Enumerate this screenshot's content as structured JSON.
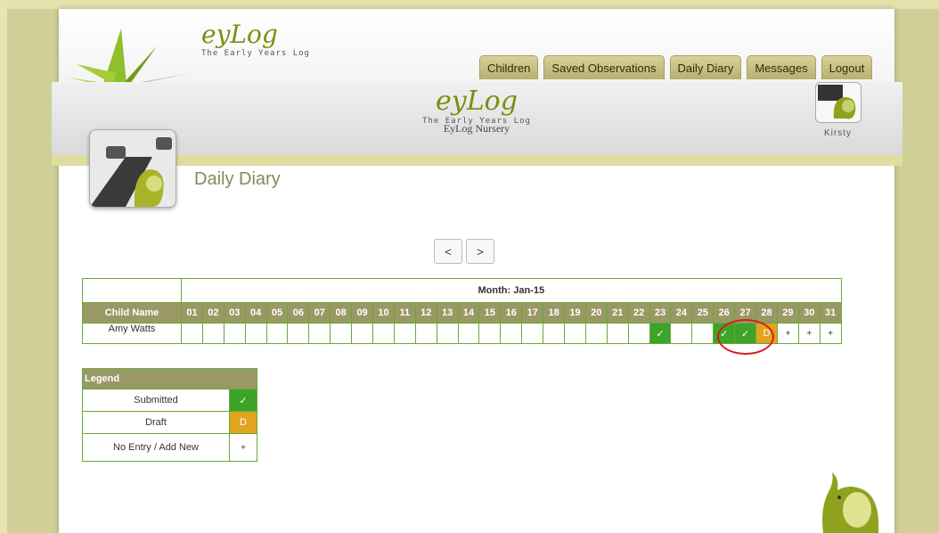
{
  "app": {
    "logo_word": "eyLog",
    "logo_tagline": "The Early Years Log",
    "nursery_name": "EyLog Nursery",
    "user_name": "Kirsty"
  },
  "tabs": [
    "Children",
    "Saved Observations",
    "Daily Diary",
    "Messages",
    "Logout"
  ],
  "page": {
    "title": "Daily Diary"
  },
  "nav": {
    "prev": "<",
    "next": ">"
  },
  "diary": {
    "month_label": "Month: Jan-15",
    "name_header": "Child Name",
    "days": [
      "01",
      "02",
      "03",
      "04",
      "05",
      "06",
      "07",
      "08",
      "09",
      "10",
      "11",
      "12",
      "13",
      "14",
      "15",
      "16",
      "17",
      "18",
      "19",
      "20",
      "21",
      "22",
      "23",
      "24",
      "25",
      "26",
      "27",
      "28",
      "29",
      "30",
      "31"
    ],
    "rows": [
      {
        "name": "Amy Watts",
        "cells": [
          "",
          "",
          "",
          "",
          "",
          "",
          "",
          "",
          "",
          "",
          "",
          "",
          "",
          "",
          "",
          "",
          "",
          "",
          "",
          "",
          "",
          "",
          "submitted",
          "",
          "",
          "submitted",
          "submitted",
          "draft",
          "add",
          "add",
          "add"
        ]
      }
    ]
  },
  "symbols": {
    "submitted": "✓",
    "draft": "D",
    "add": "+"
  },
  "legend": {
    "title": "Legend",
    "items": [
      {
        "label": "Submitted",
        "symbol": "✓",
        "type": "submitted"
      },
      {
        "label": "Draft",
        "symbol": "D",
        "type": "draft"
      },
      {
        "label": "No Entry / Add New",
        "symbol": "+",
        "type": "add"
      }
    ]
  },
  "colors": {
    "submitted": "#3ea329",
    "draft": "#e0a41e",
    "header": "#999966",
    "border": "#6aa838",
    "highlight": "#d81c1c"
  }
}
